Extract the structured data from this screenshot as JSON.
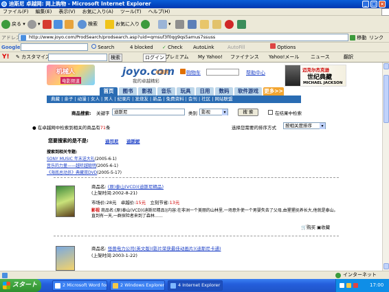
{
  "window": {
    "title": "迪斯尼 卓越网: 网上购物 - Microsoft Internet Explorer"
  },
  "menu": [
    "ファイル(F)",
    "編集(E)",
    "表示(V)",
    "お気に入り(A)",
    "ツール(T)",
    "ヘルプ(H)"
  ],
  "toolbar": {
    "back": "戻る",
    "search": "検索",
    "favorites": "お気に入り",
    "blocked": "4 blocked",
    "check": "Check",
    "autolink": "AutoLink",
    "autofill": "AutoFill",
    "options": "Options"
  },
  "address": {
    "label": "アドレス(D)",
    "url": "http://www.joyo.com/ProdSearch/prodsearch.asp?uid=qmsuf3f0qg9qs5amus7ssuss",
    "go": "移動",
    "links": "リンク"
  },
  "google": {
    "label": "Google",
    "search": "Search",
    "blocked": "4 blocked",
    "check": "Check",
    "autolink": "AutoLink",
    "autofill": "AutoFill",
    "options": "Options"
  },
  "yahoo": {
    "label": "Y!",
    "customize": "カスタマイズ",
    "search_btn": "検索",
    "login": "ログイン",
    "premium": "プレミアム",
    "my_yahoo": "My Yahoo!",
    "finance": "ファイナンス",
    "mail": "Yahoo!メール",
    "news": "ニュース",
    "translate": "翻訳"
  },
  "site": {
    "banner_left_line1": "机械人",
    "banner_left_line2": "电影频道",
    "logo": "joyo.com",
    "logo_sub": "卓越网",
    "slogan": "我的卓越精彩",
    "help_center": "帮助中心",
    "banner_right_line1": "迈克尔杰克逊",
    "banner_right_line2": "世纪典藏",
    "banner_right_line3": "MICHAEL JACKSON",
    "nav_tabs": [
      "首页",
      "图书",
      "影视",
      "音乐",
      "玩具",
      "日用",
      "数码",
      "软件游戏",
      "更多>>"
    ],
    "subnav": "典藏 | 亲子 | 动漫 | 女人 | 男人 | 纪录片 | 发烧友 | 新品 | 免费资料 | 会刊 | 社区 | 网站联盟",
    "search": {
      "label": "商品搜索:",
      "keyword_label": "关键字",
      "keyword": "迪斯尼",
      "category_label": "类别",
      "category": "影视",
      "button": "搜 索",
      "in_results": "在结果中检索"
    },
    "result_count_prefix": "在卓越网中检索到相关的商品有",
    "result_count": "71",
    "result_count_suffix": "条",
    "sort_label": "选择您需要的排序方式",
    "sort_value": "按相关度排序",
    "did_you_mean": "您要搜索的是不是:",
    "suggest1": "迪司尼",
    "suggest2": "迪斯妮",
    "topics_title": "搜索到相关专题:",
    "topics": [
      {
        "title": "SONY MUSIC 年末送大礼",
        "date": "(2005-6-1)"
      },
      {
        "title": "音乐的力量——越听越聪明",
        "date": "(2005-6-1)"
      },
      {
        "title": "《海底总动员》典藏双DVD",
        "date": "(2005-5-17)"
      }
    ],
    "products": [
      {
        "name_label": "商品名:",
        "name": "(原)泰山(VCD)(迪斯尼精品)",
        "date": "(上架时间:2002-8-21)",
        "price_label": "市场价:",
        "price": "28元",
        "joyo_label": "卓越价:",
        "joyo_price": "15元",
        "save_label": "立刻节省:",
        "save": "13元",
        "desc_label": "影视",
        "desc": "商品名:(原)泰山(VCD)(迪斯尼精品)|内容:在非洲一个美丽的山林里,一场意外使一个男婴失去了父母,由猩猩抚养长大,他就是泰山。直到有一天,一群探险者来到了森林……",
        "buy": "购买",
        "wish": "收藏"
      },
      {
        "name_label": "商品名:",
        "name": "怪兽电力公司(英文版)(影片荣获最佳动画片)(迪斯尼卡通)",
        "date": "(上架时间:2003-1-22)"
      }
    ]
  },
  "status": {
    "zone": "インターネット"
  },
  "taskbar": {
    "start": "スタート",
    "tasks": [
      "2 Microsoft Word for...",
      "2 Windows Explorer",
      "4 Internet Explorer"
    ],
    "clock": "17:00"
  }
}
